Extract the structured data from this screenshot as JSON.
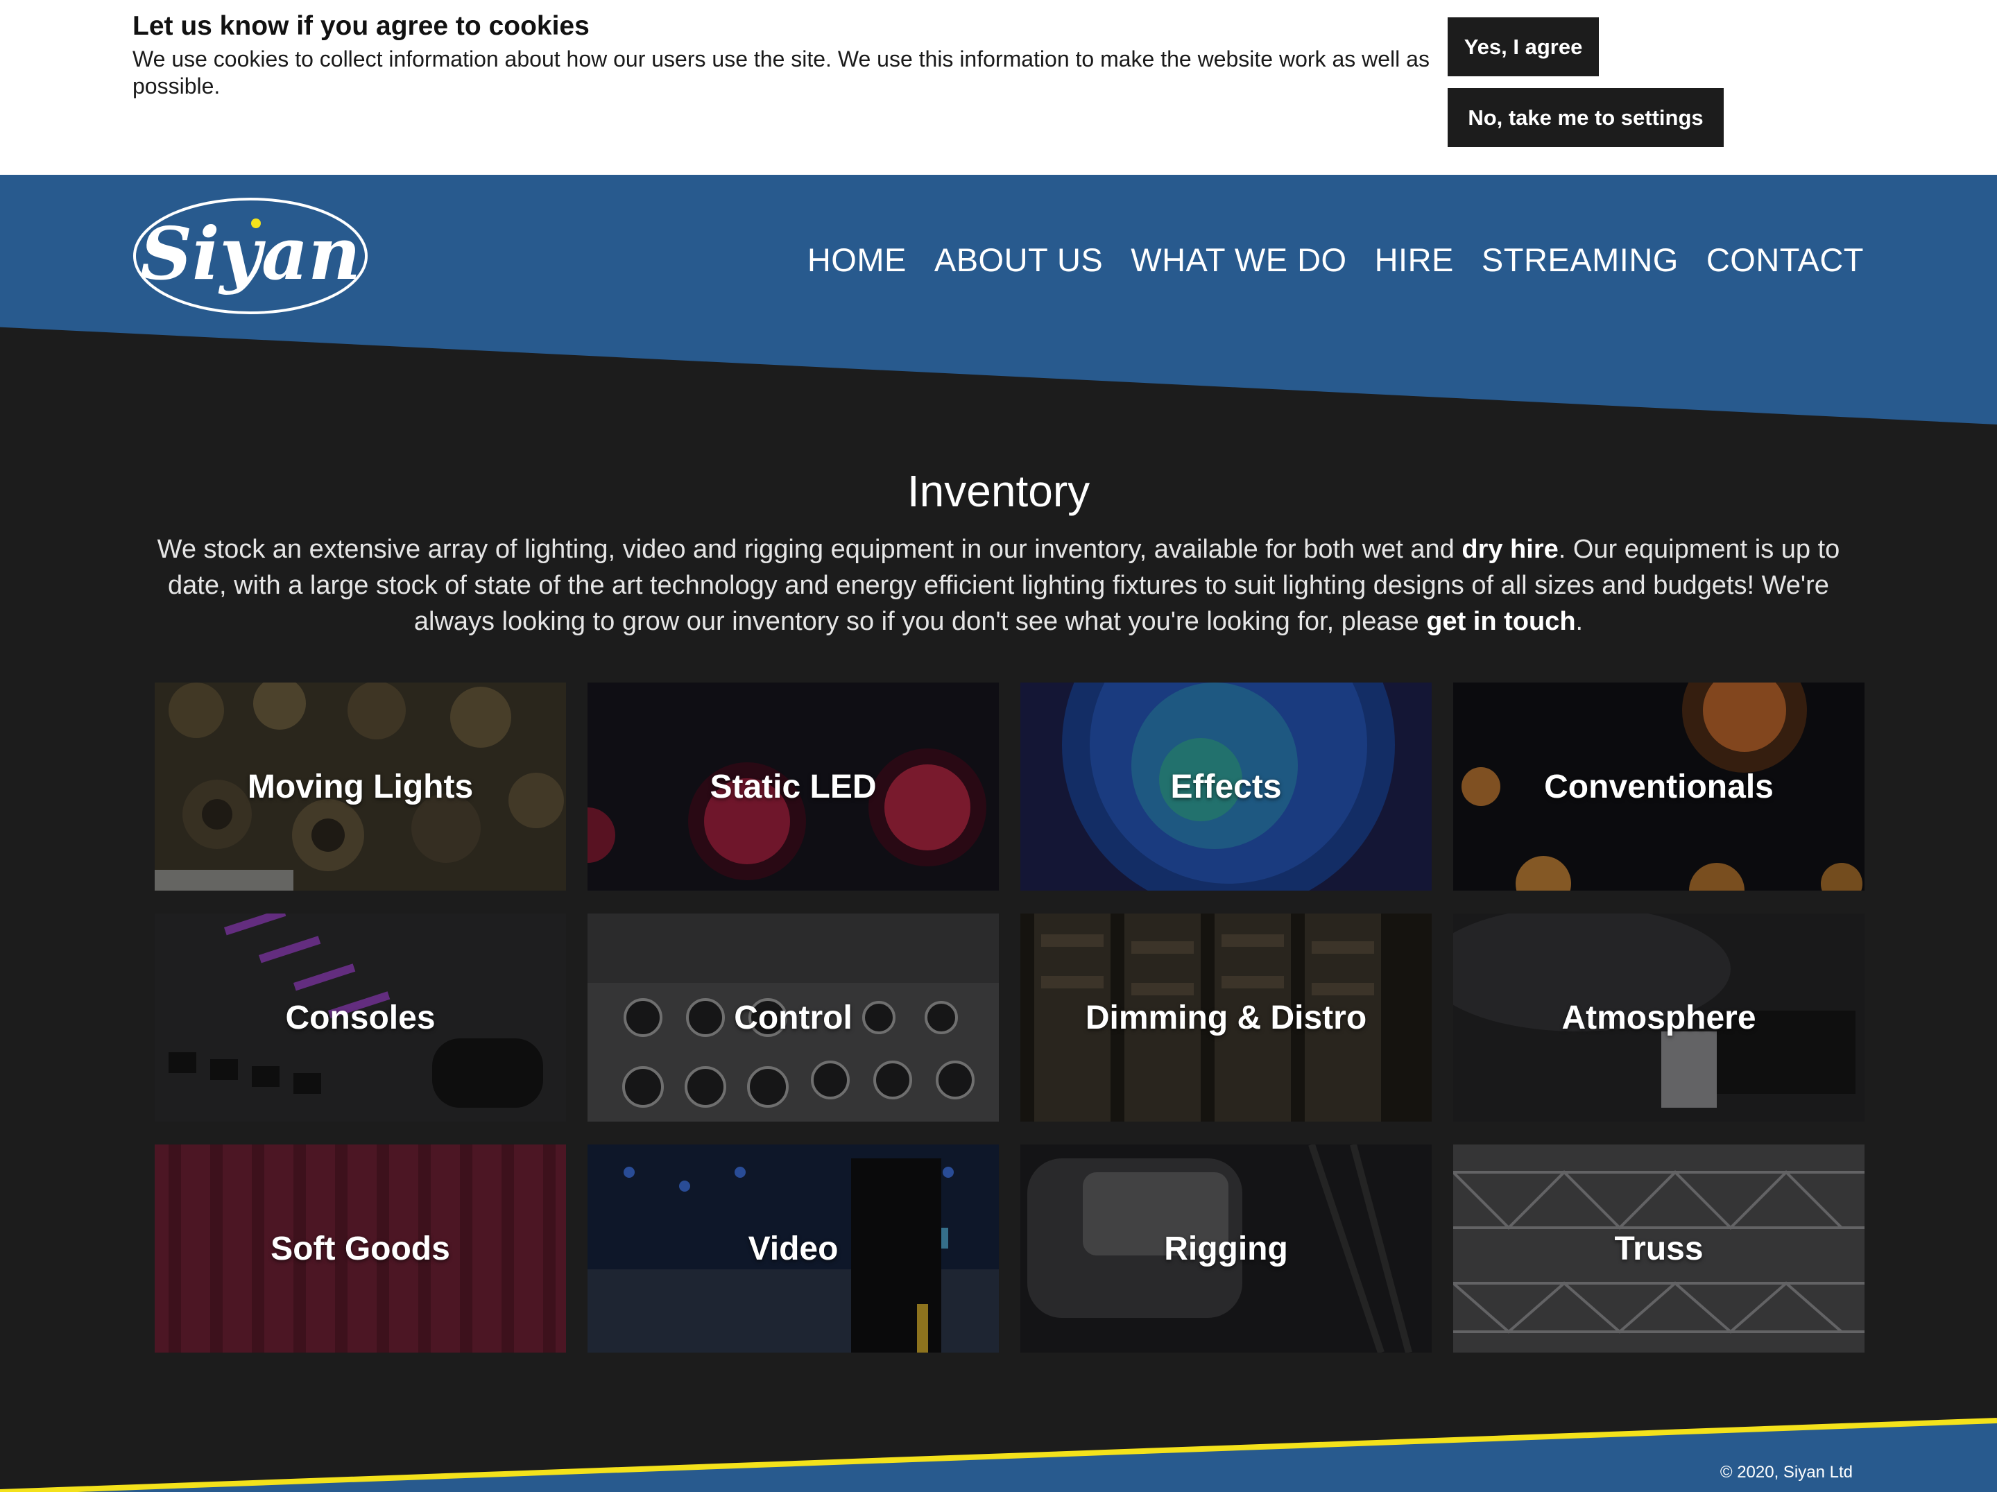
{
  "cookie": {
    "title": "Let us know if you agree to cookies",
    "text": "We use cookies to collect information about how our users use the site. We use this information to make the website work as well as possible.",
    "agree_label": "Yes, I agree",
    "settings_label": "No, take me to settings"
  },
  "brand": {
    "logo_text": "Siyan",
    "header_color": "#285a8e",
    "accent_yellow": "#f4e21b"
  },
  "nav": {
    "items": [
      {
        "label": "HOME"
      },
      {
        "label": "ABOUT US"
      },
      {
        "label": "WHAT WE DO"
      },
      {
        "label": "HIRE"
      },
      {
        "label": "STREAMING"
      },
      {
        "label": "CONTACT"
      }
    ]
  },
  "main": {
    "title": "Inventory",
    "intro_part1": "We stock an extensive array of lighting, video and rigging equipment in our inventory, available for both wet and ",
    "dry_hire_link": "dry hire",
    "intro_part2": ". Our equipment is up to date, with a large stock of state of the art technology and energy efficient lighting fixtures to suit lighting designs of all sizes and budgets! We're always looking to grow our inventory so if you don't see what you're looking for, please ",
    "get_in_touch_link": "get in touch",
    "intro_part3": "."
  },
  "categories": [
    {
      "label": "Moving Lights"
    },
    {
      "label": "Static LED"
    },
    {
      "label": "Effects"
    },
    {
      "label": "Conventionals"
    },
    {
      "label": "Consoles"
    },
    {
      "label": "Control"
    },
    {
      "label": "Dimming & Distro"
    },
    {
      "label": "Atmosphere"
    },
    {
      "label": "Soft Goods"
    },
    {
      "label": "Video"
    },
    {
      "label": "Rigging"
    },
    {
      "label": "Truss"
    }
  ],
  "footer": {
    "copyright": "© 2020, Siyan Ltd"
  }
}
